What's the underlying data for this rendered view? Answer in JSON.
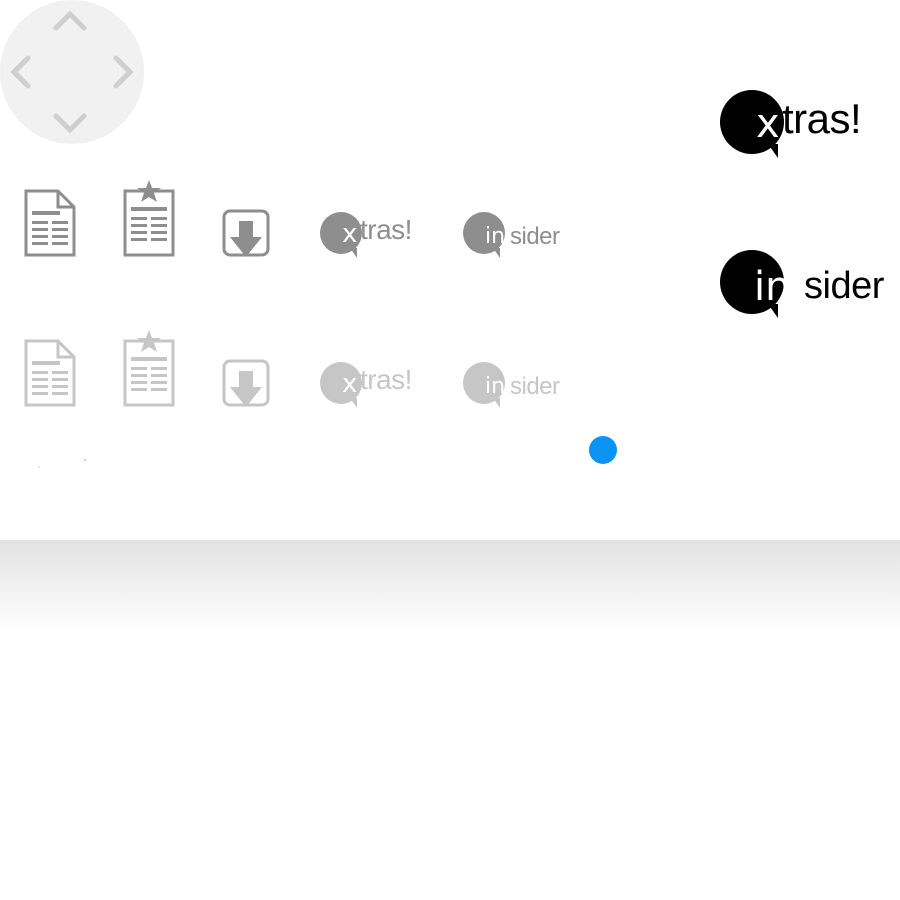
{
  "colors": {
    "dark_icon": "#8e8e8e",
    "light_icon": "#c6c6c6",
    "black": "#000000",
    "accent_blue": "#0a93f2"
  },
  "dpad": {
    "icons": [
      "chevron-up-icon",
      "chevron-down-icon",
      "chevron-left-icon",
      "chevron-right-icon"
    ]
  },
  "logos": {
    "xtras": {
      "lead": "x",
      "rest": "tras!"
    },
    "insider": {
      "lead": "in",
      "rest": "sider"
    }
  },
  "sprite_rows": [
    {
      "state": "normal",
      "icons": [
        "article-icon",
        "featured-article-icon",
        "download-icon",
        "xtras-logo",
        "insider-logo"
      ]
    },
    {
      "state": "faded",
      "icons": [
        "article-icon",
        "featured-article-icon",
        "download-icon",
        "xtras-logo",
        "insider-logo"
      ]
    }
  ]
}
